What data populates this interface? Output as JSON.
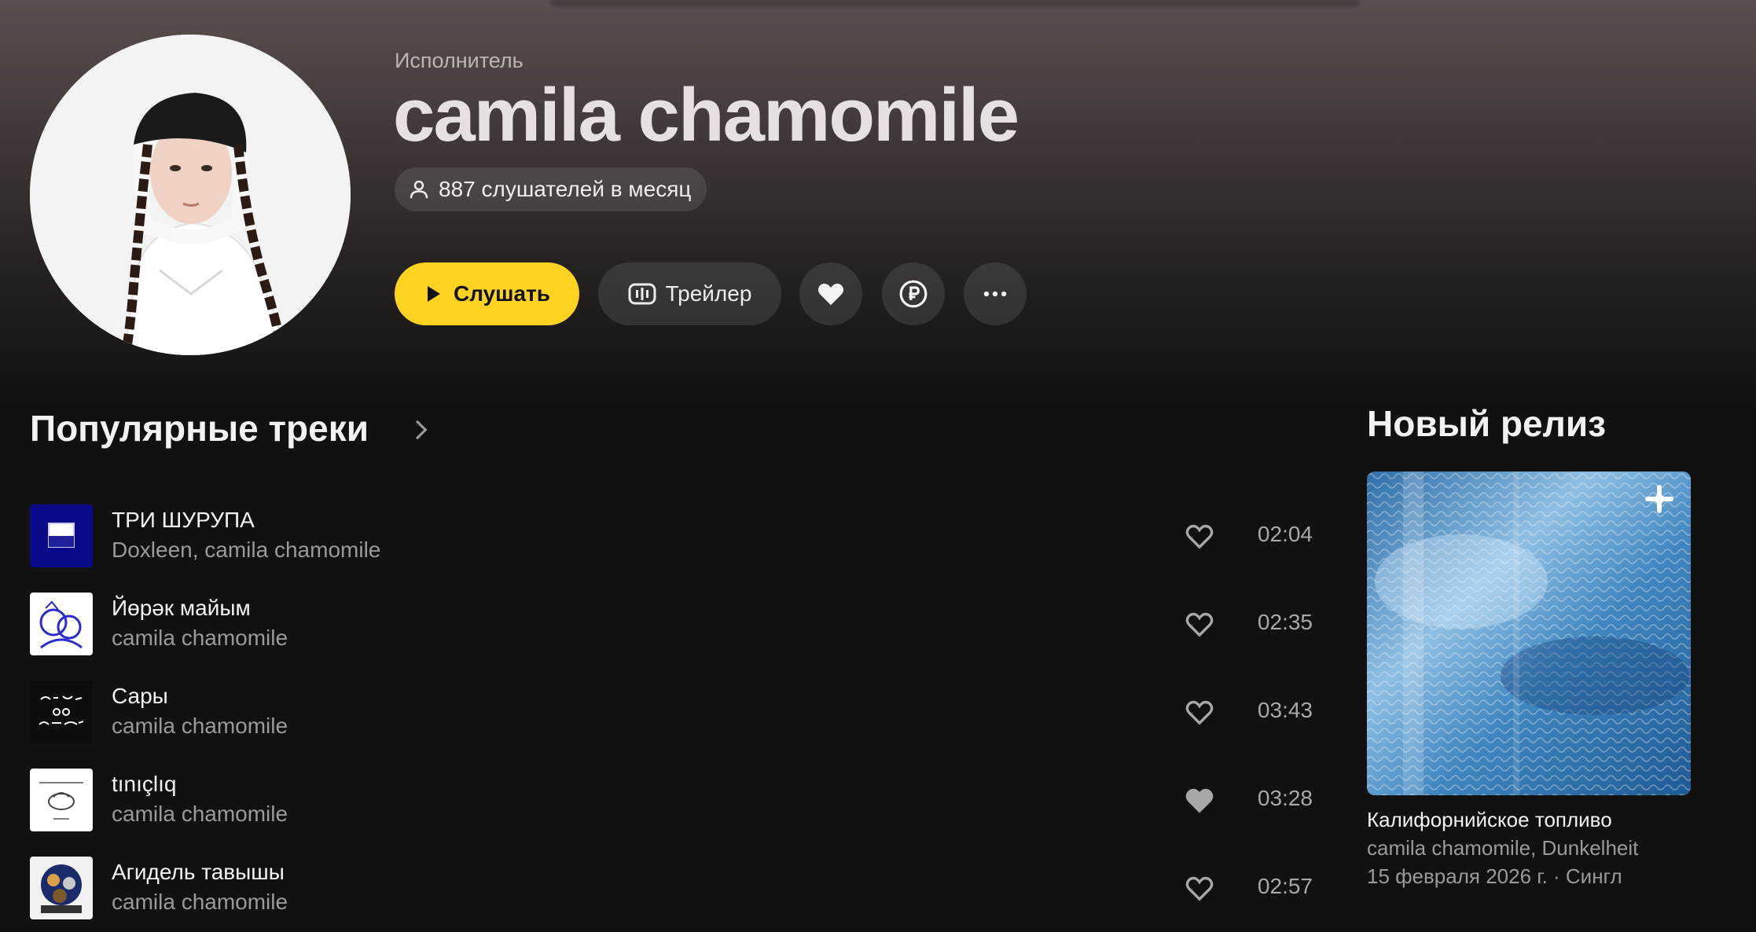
{
  "artist": {
    "label": "Исполнитель",
    "name": "camila chamomile",
    "listeners": "887 слушателей в месяц"
  },
  "actions": {
    "listen": "Слушать",
    "trailer": "Трейлер"
  },
  "popular": {
    "title": "Популярные треки",
    "tracks": [
      {
        "title": "ТРИ ШУРУПА",
        "artists": "Doxleen, camila chamomile",
        "duration": "02:04",
        "liked": false
      },
      {
        "title": "Йөрәк майым",
        "artists": "camila chamomile",
        "duration": "02:35",
        "liked": false
      },
      {
        "title": "Сары",
        "artists": "camila chamomile",
        "duration": "03:43",
        "liked": false
      },
      {
        "title": "tınıçlıq",
        "artists": "camila chamomile",
        "duration": "03:28",
        "liked": true
      },
      {
        "title": "Агидель тавышы",
        "artists": "camila chamomile",
        "duration": "02:57",
        "liked": false
      }
    ]
  },
  "new_release": {
    "title": "Новый релиз",
    "release_title": "Калифорнийское топливо",
    "artists": "camila chamomile, Dunkelheit",
    "meta": "15 февраля 2026 г. · Сингл"
  },
  "colors": {
    "accent": "#ffd320",
    "background": "#111111"
  }
}
